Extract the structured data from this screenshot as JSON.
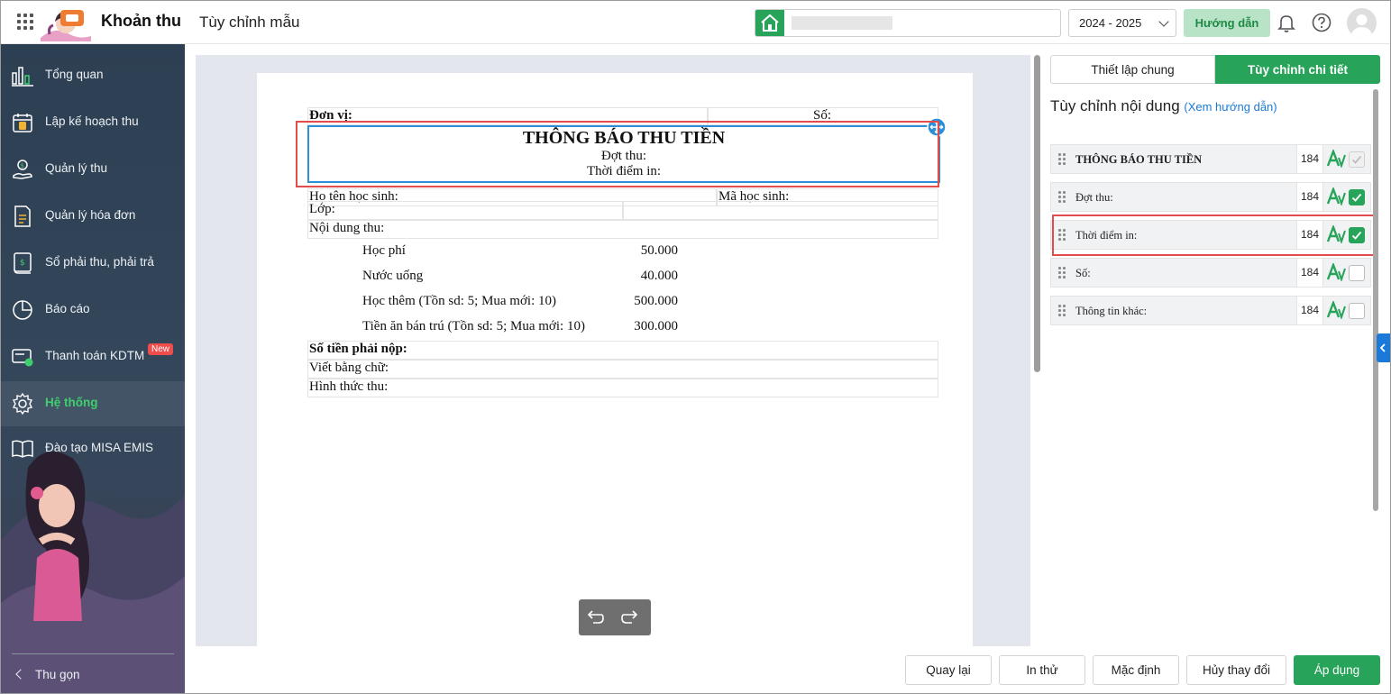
{
  "header": {
    "app_title": "Khoản thu",
    "page_title": "Tùy chỉnh mẫu",
    "school_year": "2024 - 2025",
    "guide_label": "Hướng dẫn"
  },
  "sidebar": {
    "items": [
      {
        "label": "Tổng quan",
        "icon": "chart-icon"
      },
      {
        "label": "Lập kế hoạch thu",
        "icon": "calendar-money-icon"
      },
      {
        "label": "Quản lý thu",
        "icon": "hand-money-icon"
      },
      {
        "label": "Quản lý hóa đơn",
        "icon": "invoice-icon"
      },
      {
        "label": "Sổ phải thu, phải trả",
        "icon": "ledger-icon"
      },
      {
        "label": "Báo cáo",
        "icon": "pie-chart-icon"
      },
      {
        "label": "Thanh toán KDTM",
        "icon": "card-payment-icon",
        "badge": "New"
      },
      {
        "label": "Hệ thống",
        "icon": "gear-icon",
        "active": true
      },
      {
        "label": "Đào tạo MISA EMIS",
        "icon": "book-icon"
      }
    ],
    "collapse_label": "Thu gọn"
  },
  "document": {
    "unit_label": "Đơn vị:",
    "number_label": "Số:",
    "title": "THÔNG BÁO THU TIỀN",
    "batch_label": "Đợt thu:",
    "print_time_label": "Thời điểm in:",
    "student_name_label": "Họ tên học sinh:",
    "student_code_label": "Mã học sinh:",
    "class_label": "Lớp:",
    "content_label": "Nội dung thu:",
    "fees": [
      {
        "name": "Học phí",
        "amount": "50.000"
      },
      {
        "name": "Nước uống",
        "amount": "40.000"
      },
      {
        "name": "Học thêm (Tồn sd: 5; Mua mới: 10)",
        "amount": "500.000"
      },
      {
        "name": "Tiền ăn bán trú (Tồn sd: 5; Mua mới: 10)",
        "amount": "300.000"
      }
    ],
    "total_label": "Số tiền phải nộp:",
    "in_words_label": "Viết bằng chữ:",
    "payment_method_label": "Hình thức thu:"
  },
  "panel": {
    "tabs": [
      "Thiết lập chung",
      "Tùy chỉnh chi tiết"
    ],
    "heading": "Tùy chỉnh nội dung",
    "guide_link": "(Xem hướng dẫn)",
    "rows": [
      {
        "label": "THÔNG BÁO THU TIỀN",
        "size": "184",
        "checked": true,
        "disabled": true,
        "bold": true
      },
      {
        "label": "Đợt thu:",
        "size": "184",
        "checked": true
      },
      {
        "label": "Thời điểm in:",
        "size": "184",
        "checked": true
      },
      {
        "label": "Số:",
        "size": "184",
        "checked": false
      },
      {
        "label": "Thông tin khác:",
        "size": "184",
        "checked": false
      }
    ]
  },
  "footer": {
    "buttons": [
      "Quay lại",
      "In thử",
      "Mặc định",
      "Hủy thay đổi",
      "Áp dụng"
    ]
  },
  "colors": {
    "brand_green": "#27a35a",
    "link_blue": "#1b79d8",
    "highlight_red": "#e34c4c",
    "sidebar_bg": "#2d3f52"
  }
}
